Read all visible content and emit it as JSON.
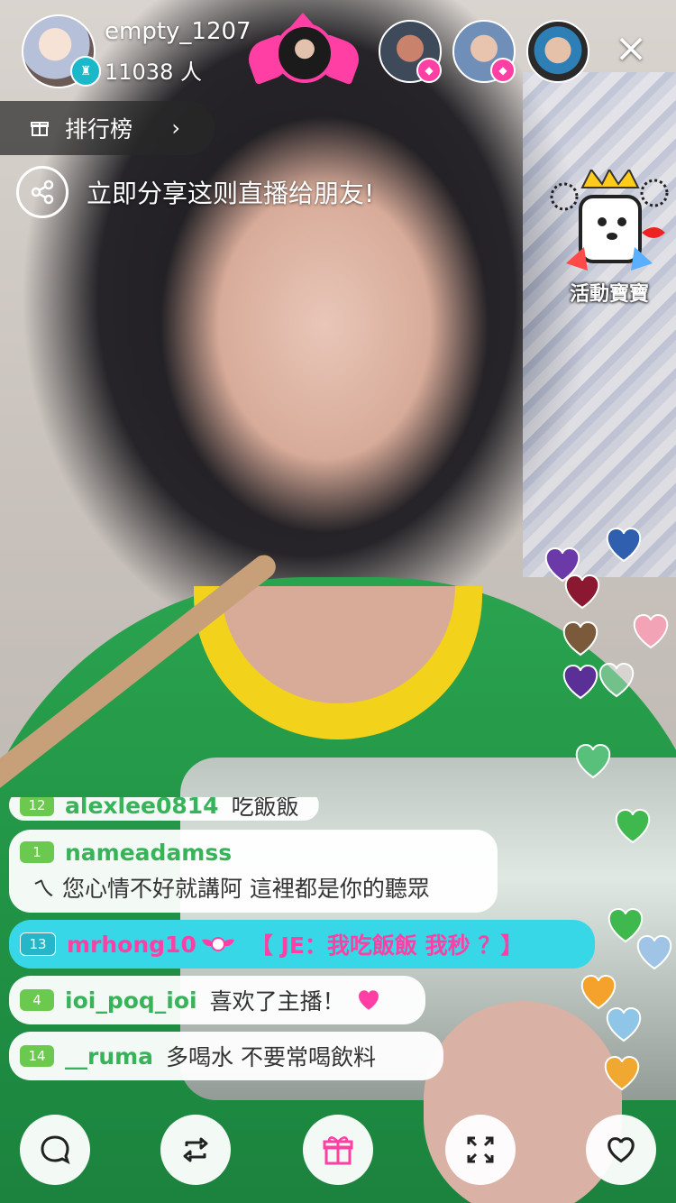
{
  "header": {
    "host_name": "empty_1207",
    "viewer_count": "11038 人",
    "close_label": "×"
  },
  "ranking": {
    "label": "排行榜",
    "chevron": "›"
  },
  "share": {
    "text": "立即分享这则直播给朋友!"
  },
  "event_badge": {
    "label": "活動寶寶"
  },
  "comments": [
    {
      "level": "12",
      "user": "alexlee0814",
      "message": "吃飯飯",
      "highlight": false
    },
    {
      "level": "1",
      "user": "nameadamss",
      "message": "ㄟ 您心情不好就講阿 這裡都是你的聽眾",
      "highlight": false
    },
    {
      "level": "13",
      "user": "mrhong10",
      "message": "【 JE：我吃飯飯 我秒 ？】",
      "highlight": true
    },
    {
      "level": "4",
      "user": "ioi_poq_ioi",
      "message": "喜欢了主播！",
      "highlight": false
    },
    {
      "level": "14",
      "user": "__ruma",
      "message": "多喝水 不要常喝飲料",
      "highlight": false
    }
  ],
  "colors": {
    "accent_pink": "#ff3fa3",
    "accent_cyan": "#37d7e8",
    "username_green": "#37b35a",
    "level_green": "#6cc94f"
  },
  "bottom_bar": [
    "chat-icon",
    "share-repost-icon",
    "gift-icon",
    "fullscreen-icon",
    "heart-icon"
  ]
}
